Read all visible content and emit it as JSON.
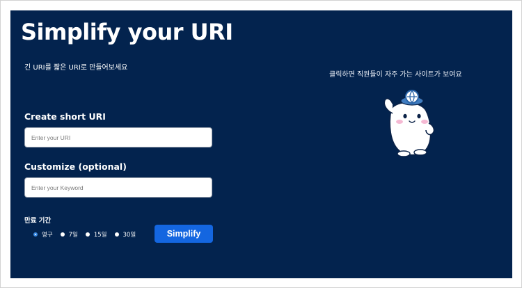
{
  "header": {
    "title": "Simplify your URI",
    "subtitle": "긴 URI를 짧은 URI로 만들어보세요"
  },
  "form": {
    "create_label": "Create short URI",
    "uri_placeholder": "Enter your URI",
    "customize_label": "Customize (optional)",
    "keyword_placeholder": "Enter your Keyword",
    "expiry_label": "만료 기간",
    "expiry_options": [
      {
        "label": "영구",
        "selected": true
      },
      {
        "label": "7일",
        "selected": false
      },
      {
        "label": "15일",
        "selected": false
      },
      {
        "label": "30일",
        "selected": false
      }
    ],
    "submit_label": "Simplify"
  },
  "side": {
    "hint": "클릭하면 직원들이 자주 가는 사이트가 보여요",
    "mascot_icon": "mascot-character-icon"
  },
  "colors": {
    "panel_bg": "#03234e",
    "button": "#1466e0",
    "radio_selected": "#3f8ee6"
  }
}
